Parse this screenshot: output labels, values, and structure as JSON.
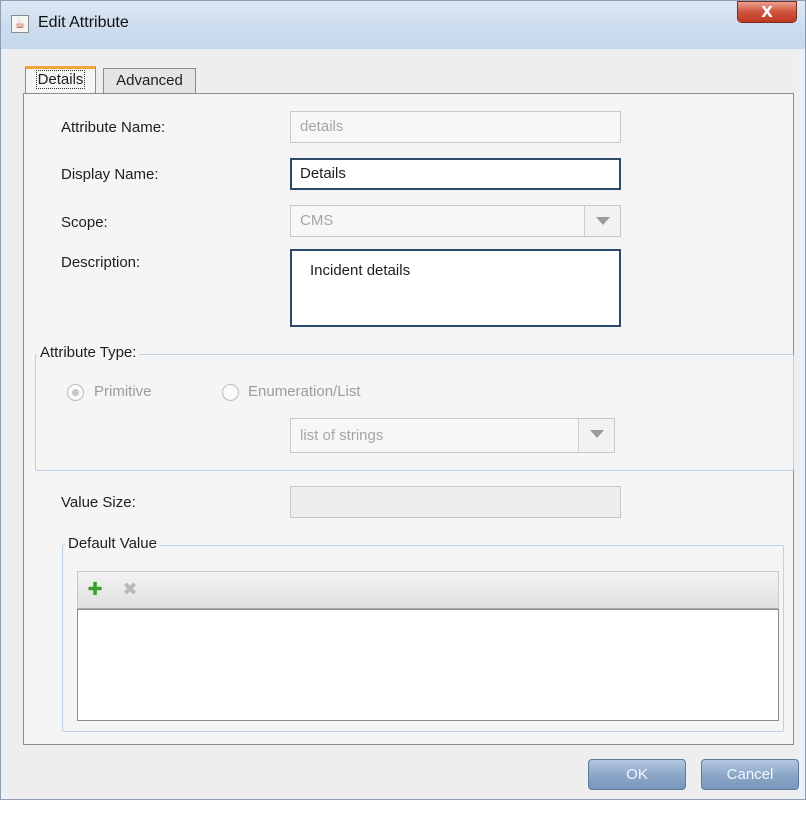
{
  "window": {
    "title": "Edit Attribute",
    "close_glyph": "X"
  },
  "tabs": [
    {
      "label": "Details",
      "active": true
    },
    {
      "label": "Advanced",
      "active": false
    }
  ],
  "form": {
    "attribute_name": {
      "label": "Attribute Name:",
      "value": "details",
      "disabled": true
    },
    "display_name": {
      "label": "Display Name:",
      "value": "Details"
    },
    "scope": {
      "label": "Scope:",
      "value": "CMS",
      "disabled": true
    },
    "description": {
      "label": "Description:",
      "value": "Incident details"
    },
    "value_size": {
      "label": "Value Size:",
      "value": "",
      "disabled": true
    }
  },
  "attribute_type": {
    "legend": "Attribute Type:",
    "primitive_label": "Primitive",
    "enumeration_label": "Enumeration/List",
    "selected": "Primitive",
    "list_type_value": "list of strings"
  },
  "default_value": {
    "legend": "Default Value",
    "add_icon": "add-icon",
    "delete_icon": "delete-icon",
    "rows": []
  },
  "buttons": {
    "ok": "OK",
    "cancel": "Cancel"
  },
  "colors": {
    "accent_tab": "#f0a63c",
    "button_blue": "#8ca8c8",
    "close_red": "#c23a22",
    "add_green": "#3aa02c"
  }
}
